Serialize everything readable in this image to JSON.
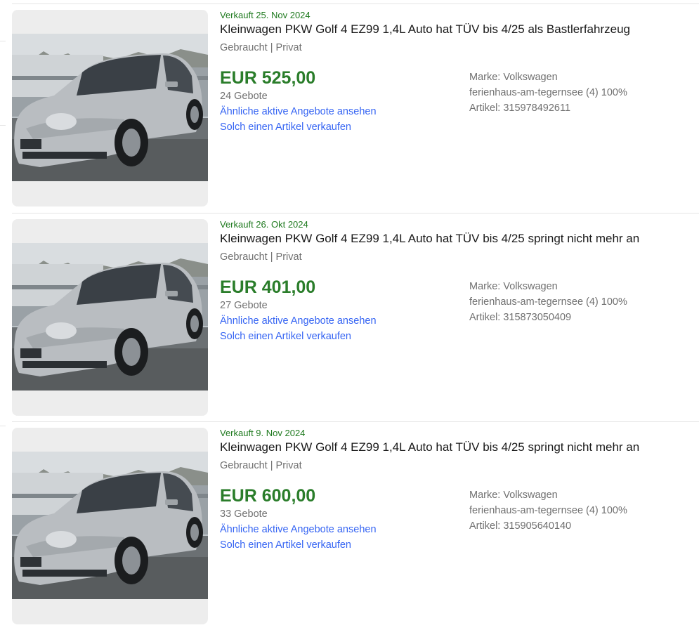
{
  "listings": [
    {
      "sold_label": "Verkauft 25. Nov 2024",
      "title": "Kleinwagen PKW Golf 4 EZ99 1,4L Auto hat TÜV bis 4/25 als Bastlerfahrzeug",
      "condition": "Gebraucht | Privat",
      "price": "EUR 525,00",
      "bids": "24 Gebote",
      "similar_link": "Ähnliche aktive Angebote ansehen",
      "sell_link": "Solch einen Artikel verkaufen",
      "brand": "Marke: Volkswagen",
      "seller": "ferienhaus-am-tegernsee (4) 100%",
      "item_number": "Artikel: 315978492611"
    },
    {
      "sold_label": "Verkauft 26. Okt 2024",
      "title": "Kleinwagen PKW Golf 4 EZ99 1,4L Auto hat TÜV bis 4/25 springt nicht mehr an",
      "condition": "Gebraucht | Privat",
      "price": "EUR 401,00",
      "bids": "27 Gebote",
      "similar_link": "Ähnliche aktive Angebote ansehen",
      "sell_link": "Solch einen Artikel verkaufen",
      "brand": "Marke: Volkswagen",
      "seller": "ferienhaus-am-tegernsee (4) 100%",
      "item_number": "Artikel: 315873050409"
    },
    {
      "sold_label": "Verkauft 9. Nov 2024",
      "title": "Kleinwagen PKW Golf 4 EZ99 1,4L Auto hat TÜV bis 4/25 springt nicht mehr an",
      "condition": "Gebraucht | Privat",
      "price": "EUR 600,00",
      "bids": "33 Gebote",
      "similar_link": "Ähnliche aktive Angebote ansehen",
      "sell_link": "Solch einen Artikel verkaufen",
      "brand": "Marke: Volkswagen",
      "seller": "ferienhaus-am-tegernsee (4) 100%",
      "item_number": "Artikel: 315905640140"
    }
  ],
  "colors": {
    "sold_green": "#1f7a1f",
    "price_green": "#2a7d2a",
    "link_blue": "#3665f3",
    "secondary_text": "#707070"
  },
  "icons": {
    "thumbnail": "car-photo"
  }
}
